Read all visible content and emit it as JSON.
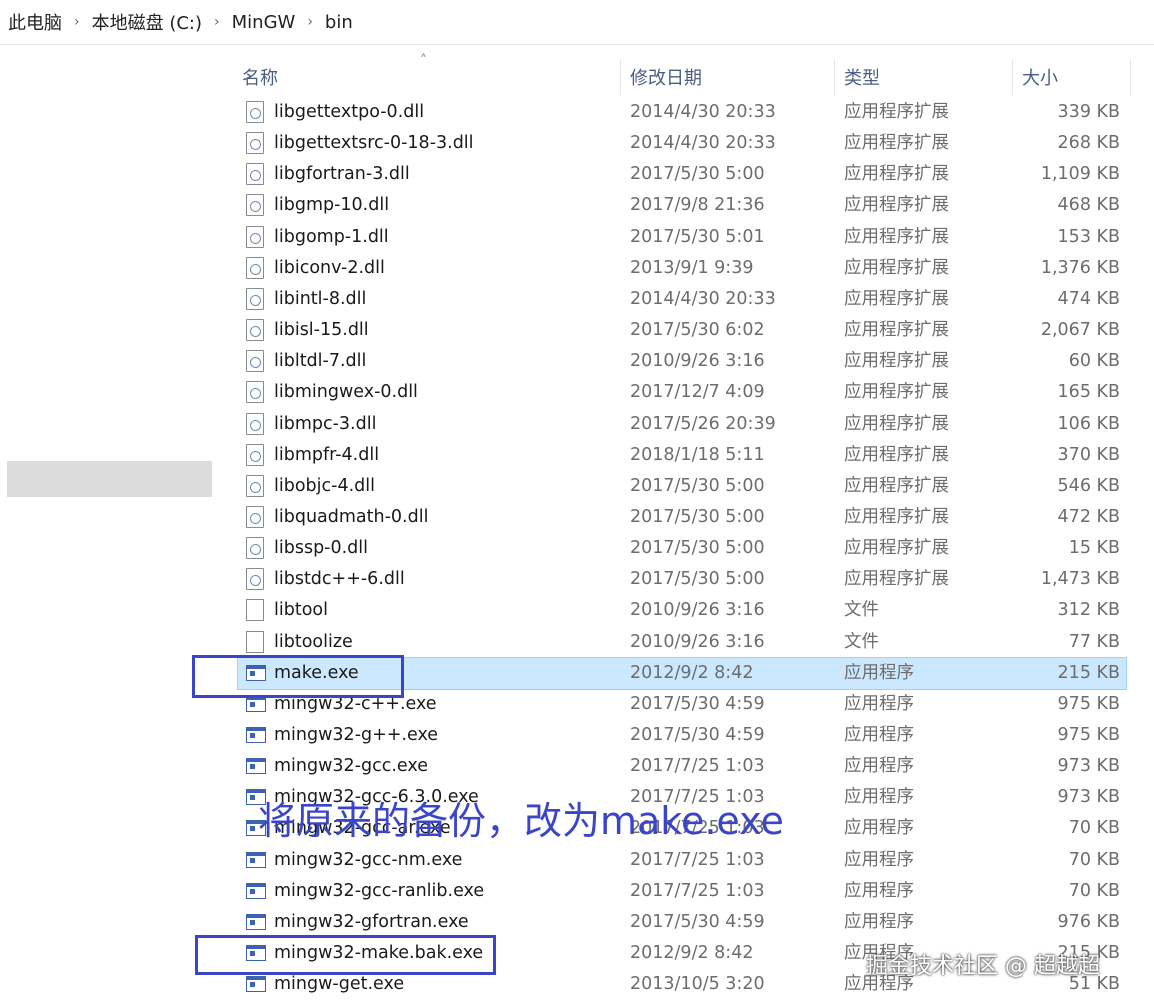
{
  "breadcrumb": [
    "此电脑",
    "本地磁盘 (C:)",
    "MinGW",
    "bin"
  ],
  "columns": {
    "name": "名称",
    "date": "修改日期",
    "type": "类型",
    "size": "大小"
  },
  "files": [
    {
      "name": "libgettextpo-0.dll",
      "date": "2014/4/30 20:33",
      "type": "应用程序扩展",
      "size": "339 KB",
      "icon": "dll-icon"
    },
    {
      "name": "libgettextsrc-0-18-3.dll",
      "date": "2014/4/30 20:33",
      "type": "应用程序扩展",
      "size": "268 KB",
      "icon": "dll-icon"
    },
    {
      "name": "libgfortran-3.dll",
      "date": "2017/5/30 5:00",
      "type": "应用程序扩展",
      "size": "1,109 KB",
      "icon": "dll-icon"
    },
    {
      "name": "libgmp-10.dll",
      "date": "2017/9/8 21:36",
      "type": "应用程序扩展",
      "size": "468 KB",
      "icon": "dll-icon"
    },
    {
      "name": "libgomp-1.dll",
      "date": "2017/5/30 5:01",
      "type": "应用程序扩展",
      "size": "153 KB",
      "icon": "dll-icon"
    },
    {
      "name": "libiconv-2.dll",
      "date": "2013/9/1 9:39",
      "type": "应用程序扩展",
      "size": "1,376 KB",
      "icon": "dll-icon"
    },
    {
      "name": "libintl-8.dll",
      "date": "2014/4/30 20:33",
      "type": "应用程序扩展",
      "size": "474 KB",
      "icon": "dll-icon"
    },
    {
      "name": "libisl-15.dll",
      "date": "2017/5/30 6:02",
      "type": "应用程序扩展",
      "size": "2,067 KB",
      "icon": "dll-icon"
    },
    {
      "name": "libltdl-7.dll",
      "date": "2010/9/26 3:16",
      "type": "应用程序扩展",
      "size": "60 KB",
      "icon": "dll-icon"
    },
    {
      "name": "libmingwex-0.dll",
      "date": "2017/12/7 4:09",
      "type": "应用程序扩展",
      "size": "165 KB",
      "icon": "dll-icon"
    },
    {
      "name": "libmpc-3.dll",
      "date": "2017/5/26 20:39",
      "type": "应用程序扩展",
      "size": "106 KB",
      "icon": "dll-icon"
    },
    {
      "name": "libmpfr-4.dll",
      "date": "2018/1/18 5:11",
      "type": "应用程序扩展",
      "size": "370 KB",
      "icon": "dll-icon"
    },
    {
      "name": "libobjc-4.dll",
      "date": "2017/5/30 5:00",
      "type": "应用程序扩展",
      "size": "546 KB",
      "icon": "dll-icon"
    },
    {
      "name": "libquadmath-0.dll",
      "date": "2017/5/30 5:00",
      "type": "应用程序扩展",
      "size": "472 KB",
      "icon": "dll-icon"
    },
    {
      "name": "libssp-0.dll",
      "date": "2017/5/30 5:00",
      "type": "应用程序扩展",
      "size": "15 KB",
      "icon": "dll-icon"
    },
    {
      "name": "libstdc++-6.dll",
      "date": "2017/5/30 5:00",
      "type": "应用程序扩展",
      "size": "1,473 KB",
      "icon": "dll-icon"
    },
    {
      "name": "libtool",
      "date": "2010/9/26 3:16",
      "type": "文件",
      "size": "312 KB",
      "icon": "file-icon"
    },
    {
      "name": "libtoolize",
      "date": "2010/9/26 3:16",
      "type": "文件",
      "size": "77 KB",
      "icon": "file-icon"
    },
    {
      "name": "make.exe",
      "date": "2012/9/2 8:42",
      "type": "应用程序",
      "size": "215 KB",
      "icon": "exe-icon",
      "selected": true
    },
    {
      "name": "mingw32-c++.exe",
      "date": "2017/5/30 4:59",
      "type": "应用程序",
      "size": "975 KB",
      "icon": "exe-icon"
    },
    {
      "name": "mingw32-g++.exe",
      "date": "2017/5/30 4:59",
      "type": "应用程序",
      "size": "975 KB",
      "icon": "exe-icon"
    },
    {
      "name": "mingw32-gcc.exe",
      "date": "2017/7/25 1:03",
      "type": "应用程序",
      "size": "973 KB",
      "icon": "exe-icon"
    },
    {
      "name": "mingw32-gcc-6.3.0.exe",
      "date": "2017/7/25 1:03",
      "type": "应用程序",
      "size": "973 KB",
      "icon": "exe-icon"
    },
    {
      "name": "mingw32-gcc-ar.exe",
      "date": "2017/7/25 1:03",
      "type": "应用程序",
      "size": "70 KB",
      "icon": "exe-icon"
    },
    {
      "name": "mingw32-gcc-nm.exe",
      "date": "2017/7/25 1:03",
      "type": "应用程序",
      "size": "70 KB",
      "icon": "exe-icon"
    },
    {
      "name": "mingw32-gcc-ranlib.exe",
      "date": "2017/7/25 1:03",
      "type": "应用程序",
      "size": "70 KB",
      "icon": "exe-icon"
    },
    {
      "name": "mingw32-gfortran.exe",
      "date": "2017/5/30 4:59",
      "type": "应用程序",
      "size": "976 KB",
      "icon": "exe-icon"
    },
    {
      "name": "mingw32-make.bak.exe",
      "date": "2012/9/2 8:42",
      "type": "应用程序",
      "size": "215 KB",
      "icon": "exe-icon"
    },
    {
      "name": "mingw-get.exe",
      "date": "2013/10/5 3:20",
      "type": "应用程序",
      "size": "51 KB",
      "icon": "exe-icon"
    }
  ],
  "annotation_text": "将原来的备份，改为make.exe",
  "watermark": "掘金技术社区 @ 超越超",
  "colors": {
    "selection": "#cce8ff",
    "annotation": "#3b45c8",
    "header_text": "#4a5e82"
  }
}
